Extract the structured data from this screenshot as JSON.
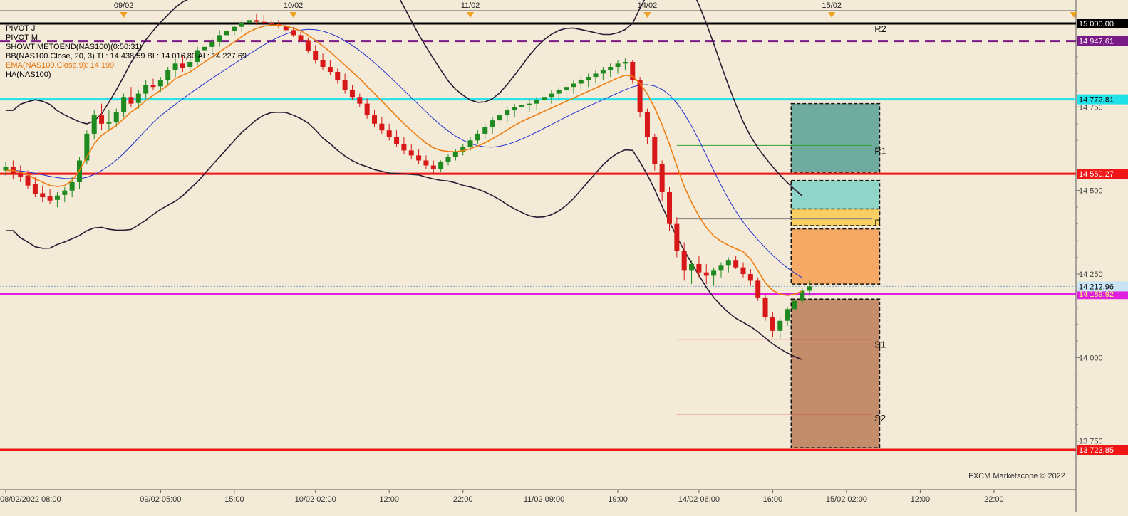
{
  "chart_data": {
    "type": "candlestick",
    "instrument": "NAS100",
    "y_ticks": [
      {
        "value": 14750,
        "label": "14 750"
      },
      {
        "value": 14500,
        "label": "14 500"
      },
      {
        "value": 14250,
        "label": "14 250"
      },
      {
        "value": 14000,
        "label": "14 000"
      },
      {
        "value": 13750,
        "label": "13 750"
      }
    ],
    "ylim": [
      13650,
      15000
    ],
    "x_ticks": [
      {
        "t": 0,
        "label": "08/02/2022 08:00"
      },
      {
        "t": 21,
        "label": "09/02 05:00"
      },
      {
        "t": 31,
        "label": "15:00"
      },
      {
        "t": 42,
        "label": "10/02 02:00"
      },
      {
        "t": 52,
        "label": "12:00"
      },
      {
        "t": 62,
        "label": "22:00"
      },
      {
        "t": 73,
        "label": "11/02 09:00"
      },
      {
        "t": 83,
        "label": "19:00"
      },
      {
        "t": 94,
        "label": "14/02 06:00"
      },
      {
        "t": 104,
        "label": "16:00"
      },
      {
        "t": 114,
        "label": "15/02 02:00"
      },
      {
        "t": 124,
        "label": "12:00"
      },
      {
        "t": 134,
        "label": "22:00"
      }
    ],
    "top_date_markers": [
      {
        "t": 16,
        "label": "09/02"
      },
      {
        "t": 39,
        "label": "10/02"
      },
      {
        "t": 63,
        "label": "11/02"
      },
      {
        "t": 87,
        "label": "14/02"
      },
      {
        "t": 112,
        "label": "15/02"
      }
    ],
    "legend": [
      {
        "text": "PIVOT J",
        "color": "#000000"
      },
      {
        "text": "PIVOT M",
        "color": "#000000"
      },
      {
        "text": "SHOWTIMETOEND(NAS100)(0:50:31)",
        "color": "#000000"
      },
      {
        "text": "BB(NAS100.Close, 20, 3)  TL: 14 438,59  BL: 14 016,80  AL: 14 227,69",
        "color": "#000000"
      },
      {
        "text": "EMA(NAS100.Close,9): 14 199",
        "color": "#e8730c"
      },
      {
        "text": "HA(NAS100)",
        "color": "#000000"
      }
    ],
    "horizontal_lines": [
      {
        "value": 15000.0,
        "label": "15 000,00",
        "color": "#000000",
        "style": "solid"
      },
      {
        "value": 14947.61,
        "label": "14 947,61",
        "color": "#7a1a86",
        "style": "dashed"
      },
      {
        "value": 14772.81,
        "label": "14 772,81",
        "color": "#20e0e8",
        "style": "solid"
      },
      {
        "value": 14550.27,
        "label": "14 550,27",
        "color": "#f01616",
        "style": "solid"
      },
      {
        "value": 14189.92,
        "label": "14 189,92",
        "color": "#e020e0",
        "style": "solid"
      },
      {
        "value": 13723.85,
        "label": "13 723,85",
        "color": "#f01616",
        "style": "solid"
      }
    ],
    "current_price": {
      "value": 14212.96,
      "label": "14 212,96",
      "color": "#1e90ff"
    },
    "pivot_labels": [
      {
        "text": "R2",
        "value": 14985
      },
      {
        "text": "R1",
        "value": 14620
      },
      {
        "text": "P",
        "value": 14405
      },
      {
        "text": "S1",
        "value": 14040
      },
      {
        "text": "S2",
        "value": 13820
      }
    ],
    "pivot_lines": [
      {
        "value": 14635,
        "color": "#2ca02c"
      },
      {
        "value": 14415,
        "color": "#808080"
      },
      {
        "value": 14055,
        "color": "#d62020"
      },
      {
        "value": 13831,
        "color": "#d62020"
      }
    ],
    "zones": [
      {
        "from": 14555,
        "to": 14760,
        "color": "#6fab9e"
      },
      {
        "from": 14430,
        "to": 14530,
        "color": "#8fd5c8"
      },
      {
        "from": 14395,
        "to": 14445,
        "color": "#f7cf62"
      },
      {
        "from": 14220,
        "to": 14385,
        "color": "#f6a965"
      },
      {
        "from": 13730,
        "to": 14175,
        "color": "#c38c6a"
      }
    ],
    "candles": [
      [
        14560,
        14585,
        14545,
        14570
      ],
      [
        14570,
        14590,
        14535,
        14550
      ],
      [
        14552,
        14575,
        14525,
        14540
      ],
      [
        14545,
        14560,
        14505,
        14515
      ],
      [
        14520,
        14540,
        14480,
        14490
      ],
      [
        14492,
        14515,
        14465,
        14480
      ],
      [
        14482,
        14505,
        14460,
        14470
      ],
      [
        14472,
        14495,
        14450,
        14485
      ],
      [
        14487,
        14510,
        14465,
        14500
      ],
      [
        14500,
        14540,
        14480,
        14525
      ],
      [
        14525,
        14600,
        14505,
        14590
      ],
      [
        14590,
        14680,
        14580,
        14670
      ],
      [
        14670,
        14740,
        14655,
        14725
      ],
      [
        14725,
        14760,
        14680,
        14700
      ],
      [
        14700,
        14740,
        14680,
        14705
      ],
      [
        14705,
        14745,
        14690,
        14735
      ],
      [
        14735,
        14790,
        14720,
        14780
      ],
      [
        14780,
        14810,
        14750,
        14760
      ],
      [
        14762,
        14800,
        14745,
        14790
      ],
      [
        14790,
        14830,
        14775,
        14815
      ],
      [
        14815,
        14835,
        14800,
        14810
      ],
      [
        14812,
        14840,
        14795,
        14830
      ],
      [
        14830,
        14870,
        14815,
        14860
      ],
      [
        14860,
        14895,
        14840,
        14880
      ],
      [
        14880,
        14905,
        14855,
        14868
      ],
      [
        14870,
        14900,
        14860,
        14885
      ],
      [
        14885,
        14930,
        14875,
        14920
      ],
      [
        14920,
        14950,
        14905,
        14930
      ],
      [
        14930,
        14955,
        14915,
        14945
      ],
      [
        14945,
        14980,
        14930,
        14965
      ],
      [
        14965,
        14985,
        14950,
        14978
      ],
      [
        14978,
        14995,
        14965,
        14990
      ],
      [
        14990,
        15010,
        14975,
        15000
      ],
      [
        15000,
        15020,
        14990,
        15010
      ],
      [
        15010,
        15030,
        14995,
        15005
      ],
      [
        15005,
        15025,
        14990,
        15002
      ],
      [
        15002,
        15015,
        14990,
        14998
      ],
      [
        14998,
        15010,
        14985,
        14992
      ],
      [
        14992,
        15005,
        14975,
        14980
      ],
      [
        14980,
        14990,
        14960,
        14965
      ],
      [
        14965,
        14975,
        14945,
        14950
      ],
      [
        14950,
        14958,
        14910,
        14918
      ],
      [
        14918,
        14935,
        14880,
        14890
      ],
      [
        14890,
        14910,
        14860,
        14870
      ],
      [
        14870,
        14890,
        14845,
        14855
      ],
      [
        14855,
        14865,
        14820,
        14830
      ],
      [
        14830,
        14850,
        14790,
        14800
      ],
      [
        14800,
        14815,
        14770,
        14780
      ],
      [
        14780,
        14790,
        14750,
        14760
      ],
      [
        14760,
        14775,
        14715,
        14725
      ],
      [
        14725,
        14740,
        14690,
        14700
      ],
      [
        14700,
        14720,
        14670,
        14680
      ],
      [
        14680,
        14700,
        14650,
        14660
      ],
      [
        14660,
        14680,
        14630,
        14640
      ],
      [
        14640,
        14660,
        14610,
        14620
      ],
      [
        14620,
        14640,
        14595,
        14605
      ],
      [
        14605,
        14625,
        14580,
        14590
      ],
      [
        14590,
        14605,
        14565,
        14575
      ],
      [
        14575,
        14590,
        14550,
        14565
      ],
      [
        14565,
        14590,
        14555,
        14585
      ],
      [
        14585,
        14610,
        14575,
        14600
      ],
      [
        14600,
        14625,
        14590,
        14615
      ],
      [
        14615,
        14640,
        14605,
        14630
      ],
      [
        14630,
        14660,
        14620,
        14650
      ],
      [
        14650,
        14680,
        14640,
        14670
      ],
      [
        14670,
        14700,
        14655,
        14690
      ],
      [
        14690,
        14720,
        14670,
        14710
      ],
      [
        14710,
        14735,
        14690,
        14725
      ],
      [
        14725,
        14750,
        14705,
        14740
      ],
      [
        14740,
        14760,
        14720,
        14750
      ],
      [
        14750,
        14770,
        14730,
        14755
      ],
      [
        14755,
        14775,
        14735,
        14760
      ],
      [
        14760,
        14780,
        14740,
        14770
      ],
      [
        14770,
        14790,
        14750,
        14780
      ],
      [
        14780,
        14800,
        14760,
        14790
      ],
      [
        14790,
        14810,
        14770,
        14800
      ],
      [
        14800,
        14820,
        14780,
        14810
      ],
      [
        14810,
        14830,
        14790,
        14820
      ],
      [
        14820,
        14840,
        14800,
        14830
      ],
      [
        14830,
        14850,
        14810,
        14840
      ],
      [
        14840,
        14860,
        14820,
        14850
      ],
      [
        14850,
        14870,
        14830,
        14860
      ],
      [
        14860,
        14880,
        14840,
        14870
      ],
      [
        14870,
        14890,
        14850,
        14880
      ],
      [
        14880,
        14895,
        14860,
        14885
      ],
      [
        14885,
        14890,
        14820,
        14830
      ],
      [
        14830,
        14840,
        14720,
        14735
      ],
      [
        14735,
        14745,
        14640,
        14660
      ],
      [
        14660,
        14670,
        14560,
        14580
      ],
      [
        14580,
        14590,
        14470,
        14495
      ],
      [
        14495,
        14510,
        14380,
        14400
      ],
      [
        14400,
        14420,
        14300,
        14320
      ],
      [
        14320,
        14345,
        14230,
        14260
      ],
      [
        14260,
        14290,
        14220,
        14280
      ],
      [
        14280,
        14305,
        14240,
        14255
      ],
      [
        14255,
        14280,
        14220,
        14245
      ],
      [
        14245,
        14270,
        14215,
        14260
      ],
      [
        14260,
        14285,
        14240,
        14275
      ],
      [
        14275,
        14300,
        14255,
        14290
      ],
      [
        14290,
        14305,
        14265,
        14270
      ],
      [
        14270,
        14285,
        14240,
        14250
      ],
      [
        14250,
        14265,
        14215,
        14230
      ],
      [
        14230,
        14240,
        14170,
        14180
      ],
      [
        14180,
        14190,
        14110,
        14120
      ],
      [
        14120,
        14135,
        14060,
        14080
      ],
      [
        14080,
        14120,
        14055,
        14110
      ],
      [
        14110,
        14150,
        14095,
        14145
      ],
      [
        14145,
        14180,
        14130,
        14170
      ],
      [
        14170,
        14210,
        14160,
        14200
      ],
      [
        14200,
        14230,
        14185,
        14213
      ]
    ],
    "ema9": [
      14560,
      14560,
      14555,
      14548,
      14535,
      14525,
      14515,
      14512,
      14515,
      14530,
      14560,
      14600,
      14640,
      14665,
      14680,
      14695,
      14715,
      14735,
      14750,
      14770,
      14785,
      14800,
      14815,
      14835,
      14845,
      14855,
      14870,
      14885,
      14900,
      14915,
      14930,
      14945,
      14960,
      14975,
      14985,
      14992,
      14995,
      14995,
      14992,
      14986,
      14978,
      14965,
      14950,
      14932,
      14915,
      14895,
      14875,
      14855,
      14835,
      14812,
      14790,
      14768,
      14745,
      14722,
      14700,
      14680,
      14660,
      14642,
      14628,
      14620,
      14617,
      14616,
      14619,
      14625,
      14633,
      14643,
      14655,
      14668,
      14681,
      14695,
      14707,
      14717,
      14727,
      14737,
      14747,
      14757,
      14767,
      14777,
      14787,
      14797,
      14807,
      14817,
      14827,
      14837,
      14845,
      14842,
      14821,
      14789,
      14747,
      14697,
      14638,
      14574,
      14512,
      14465,
      14423,
      14389,
      14364,
      14348,
      14336,
      14326,
      14317,
      14295,
      14260,
      14224,
      14201,
      14190,
      14186,
      14190,
      14199
    ]
  }
}
